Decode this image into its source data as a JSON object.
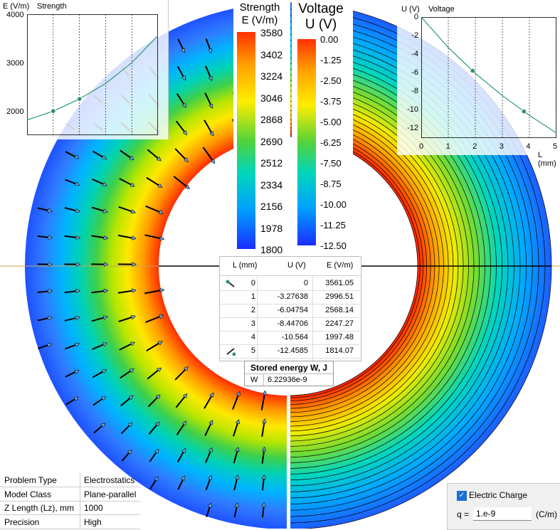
{
  "colors": {
    "background": "#ffffff",
    "axis_line": "#c8a060",
    "curve": "#2c9b72",
    "marker": "#2f8f5e"
  },
  "strength_scale": {
    "title_line1": "Strength",
    "title_line2": "E (V/m)",
    "ticks": [
      "3580",
      "3402",
      "3224",
      "3046",
      "2868",
      "2690",
      "2512",
      "2334",
      "2156",
      "1978",
      "1800"
    ]
  },
  "voltage_scale": {
    "title_line1": "Voltage",
    "title_line2": "U (V)",
    "ticks": [
      "0.00",
      "-1.25",
      "-2.50",
      "-3.75",
      "-5.00",
      "-6.25",
      "-7.50",
      "-8.75",
      "-10.00",
      "-11.25",
      "-12.50"
    ]
  },
  "chart_data": [
    {
      "type": "line",
      "title": "Strength",
      "ylabel": "E (V/m)",
      "y_ticks": [
        "4000",
        "3000",
        "2000"
      ],
      "ylim": [
        1500,
        4000
      ],
      "xlim": [
        0,
        5
      ],
      "grid": true,
      "x": [
        0,
        1,
        2,
        3,
        4,
        5
      ],
      "values": [
        1814.07,
        1997.48,
        2247.27,
        2568.14,
        2996.51,
        3561.05
      ],
      "markers_x": [
        1,
        2
      ]
    },
    {
      "type": "line",
      "title": "Voltage",
      "ylabel": "U (V)",
      "xlabel": "L (mm)",
      "y_ticks": [
        "0",
        "-2",
        "-4",
        "-6",
        "-8",
        "-10",
        "-12"
      ],
      "x_ticks": [
        "0",
        "1",
        "2",
        "3",
        "4",
        "5"
      ],
      "ylim": [
        -13,
        0
      ],
      "xlim": [
        0,
        5
      ],
      "grid": true,
      "x": [
        0,
        1,
        2,
        3,
        4,
        5
      ],
      "values": [
        0,
        -3.27638,
        -6.04754,
        -8.44706,
        -10.564,
        -12.4585
      ],
      "markers_x": [
        1.9,
        3.8
      ]
    }
  ],
  "results_table": {
    "headers": [
      "L (mm)",
      "U (V)",
      "E (V/m)"
    ],
    "rows": [
      [
        "0",
        "0",
        "3561.05"
      ],
      [
        "1",
        "-3.27638",
        "2996.51"
      ],
      [
        "2",
        "-6.04754",
        "2568.14"
      ],
      [
        "3",
        "-8.44706",
        "2247.27"
      ],
      [
        "4",
        "-10.564",
        "1997.48"
      ],
      [
        "5",
        "-12.4585",
        "1814.07"
      ]
    ]
  },
  "energy_table": {
    "title": "Stored energy W, J",
    "label": "W",
    "value": "6.22936e-9"
  },
  "problem_table": {
    "rows": [
      {
        "label": "Problem Type",
        "value": "Electrostatics"
      },
      {
        "label": "Model Class",
        "value": "Plane-parallel"
      },
      {
        "label": "Z Length (Lz), mm",
        "value": "1000"
      },
      {
        "label": "Precision",
        "value": "High"
      }
    ]
  },
  "charge_panel": {
    "checkbox_label": "Electric Charge",
    "checked": true,
    "q_label": "q =",
    "q_value": "1.e-9",
    "unit": "(C/m)"
  }
}
